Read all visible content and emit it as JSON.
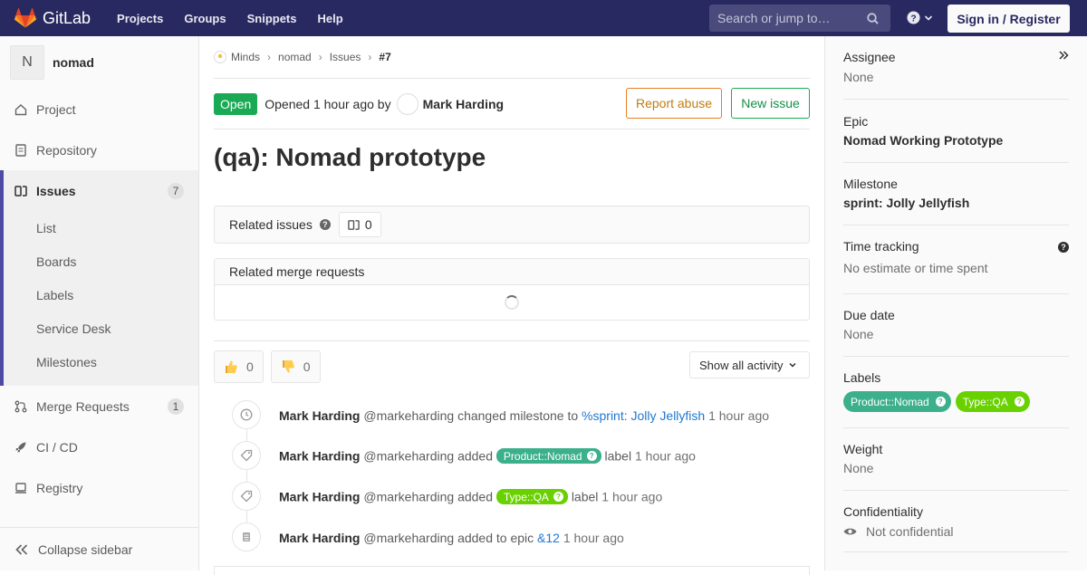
{
  "navbar": {
    "brand": "GitLab",
    "links": [
      "Projects",
      "Groups",
      "Snippets",
      "Help"
    ],
    "search_placeholder": "Search or jump to…",
    "sign_in": "Sign in / Register"
  },
  "sidebar": {
    "project_initial": "N",
    "project_name": "nomad",
    "items": [
      {
        "label": "Project",
        "icon": "home-icon"
      },
      {
        "label": "Repository",
        "icon": "doc-icon"
      },
      {
        "label": "Issues",
        "icon": "issues-icon",
        "badge": "7"
      },
      {
        "label": "Merge Requests",
        "icon": "merge-icon",
        "badge": "1"
      },
      {
        "label": "CI / CD",
        "icon": "rocket-icon"
      },
      {
        "label": "Registry",
        "icon": "registry-icon"
      }
    ],
    "sub_items": [
      "List",
      "Boards",
      "Labels",
      "Service Desk",
      "Milestones"
    ],
    "collapse": "Collapse sidebar"
  },
  "breadcrumb": {
    "items": [
      "Minds",
      "nomad",
      "Issues"
    ],
    "current": "#7"
  },
  "issue": {
    "status": "Open",
    "opened_text": "Opened 1 hour ago by",
    "author": "Mark Harding",
    "report_abuse": "Report abuse",
    "new_issue": "New issue",
    "title": "(qa): Nomad prototype",
    "related_issues_label": "Related issues",
    "related_issues_count": "0",
    "related_mr_label": "Related merge requests",
    "thumbs_up_count": "0",
    "thumbs_down_count": "0",
    "activity_filter": "Show all activity"
  },
  "notes": [
    {
      "author": "Mark Harding",
      "handle": "@markeharding",
      "action": "changed milestone to",
      "link": "%sprint: Jolly Jellyfish",
      "time": "1 hour ago",
      "icon": "clock-icon"
    },
    {
      "author": "Mark Harding",
      "handle": "@markeharding",
      "action": "added",
      "label": "Product::Nomad",
      "label_color": "#3cb08b",
      "suffix": "label",
      "time": "1 hour ago",
      "icon": "tag-icon"
    },
    {
      "author": "Mark Harding",
      "handle": "@markeharding",
      "action": "added",
      "label": "Type::QA",
      "label_color": "#69d100",
      "suffix": "label",
      "time": "1 hour ago",
      "icon": "tag-icon"
    },
    {
      "author": "Mark Harding",
      "handle": "@markeharding",
      "action": "added to epic",
      "link": "&12",
      "time": "1 hour ago",
      "icon": "epic-icon"
    }
  ],
  "right_sidebar": {
    "assignee_title": "Assignee",
    "assignee_value": "None",
    "epic_title": "Epic",
    "epic_value": "Nomad Working Prototype",
    "milestone_title": "Milestone",
    "milestone_value": "sprint: Jolly Jellyfish",
    "time_title": "Time tracking",
    "time_value": "No estimate or time spent",
    "due_title": "Due date",
    "due_value": "None",
    "labels_title": "Labels",
    "labels": [
      {
        "name": "Product::Nomad",
        "color": "#3cb08b"
      },
      {
        "name": "Type::QA",
        "color": "#69d100"
      }
    ],
    "weight_title": "Weight",
    "weight_value": "None",
    "conf_title": "Confidentiality",
    "conf_value": "Not confidential"
  },
  "colors": {
    "navbar": "#292961",
    "open_status": "#1aaa55",
    "link": "#1f78d1",
    "active_sidebar_accent": "#4b4ba3"
  }
}
